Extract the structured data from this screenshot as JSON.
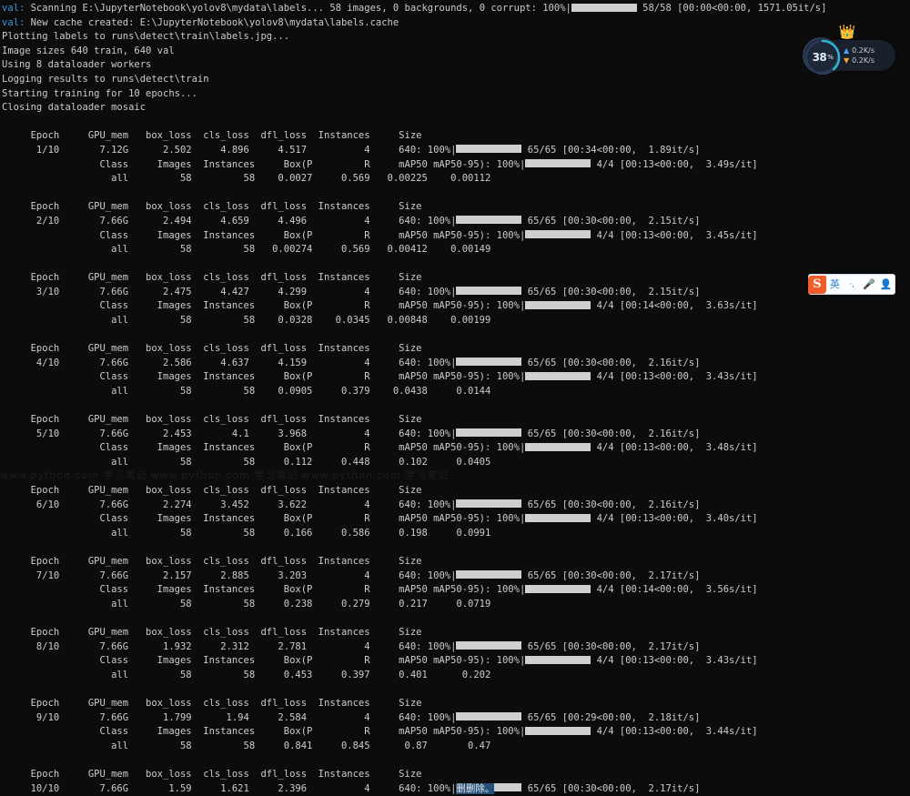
{
  "terminal": {
    "header_lines": [
      {
        "prefix": "val: ",
        "prefix_color": "cyan",
        "text": "Scanning E:\\JupyterNotebook\\yolov8\\mydata\\labels... 58 images, 0 backgrounds, 0 corrupt: 100%",
        "bar": true,
        "suffix": "58/58 [00:00<00:00, 1571.05it/s]"
      },
      {
        "prefix": "val: ",
        "prefix_color": "cyan",
        "text": "New cache created: E:\\JupyterNotebook\\yolov8\\mydata\\labels.cache",
        "bar": false,
        "suffix": ""
      },
      {
        "prefix": "",
        "prefix_color": "",
        "text": "Plotting labels to runs\\detect\\train\\labels.jpg...",
        "bar": false,
        "suffix": ""
      },
      {
        "prefix": "",
        "prefix_color": "",
        "text": "Image sizes 640 train, 640 val",
        "bar": false,
        "suffix": ""
      },
      {
        "prefix": "",
        "prefix_color": "",
        "text": "Using 8 dataloader workers",
        "bar": false,
        "suffix": ""
      },
      {
        "prefix": "",
        "prefix_color": "",
        "text": "Logging results to runs\\detect\\train",
        "bar": false,
        "suffix": ""
      },
      {
        "prefix": "",
        "prefix_color": "",
        "text": "Starting training for 10 epochs...",
        "bar": false,
        "suffix": ""
      },
      {
        "prefix": "",
        "prefix_color": "",
        "text": "Closing dataloader mosaic",
        "bar": false,
        "suffix": ""
      }
    ],
    "train_headers": [
      "Epoch",
      "GPU_mem",
      "box_loss",
      "cls_loss",
      "dfl_loss",
      "Instances",
      "Size"
    ],
    "val_headers": [
      "Class",
      "Images",
      "Instances",
      "Box(P",
      "R",
      "mAP50",
      "mAP50-95)"
    ],
    "epochs": [
      {
        "epoch": "1/10",
        "gpu_mem": "7.12G",
        "box_loss": "2.502",
        "cls_loss": "4.896",
        "dfl_loss": "4.517",
        "instances": "4",
        "size": "640",
        "train_pct": "100%",
        "train_count": "65/65",
        "train_time": "[00:34<00:00,  1.89it/s]",
        "val_pct": "100%",
        "val_count": "4/4",
        "val_time": "[00:13<00:00,  3.49s/it]",
        "class": "all",
        "images": "58",
        "val_instances": "58",
        "p": "0.0027",
        "r": "0.569",
        "map50": "0.00225",
        "map5095": "0.00112",
        "selected": false
      },
      {
        "epoch": "2/10",
        "gpu_mem": "7.66G",
        "box_loss": "2.494",
        "cls_loss": "4.659",
        "dfl_loss": "4.496",
        "instances": "4",
        "size": "640",
        "train_pct": "100%",
        "train_count": "65/65",
        "train_time": "[00:30<00:00,  2.15it/s]",
        "val_pct": "100%",
        "val_count": "4/4",
        "val_time": "[00:13<00:00,  3.45s/it]",
        "class": "all",
        "images": "58",
        "val_instances": "58",
        "p": "0.00274",
        "r": "0.569",
        "map50": "0.00412",
        "map5095": "0.00149",
        "selected": false
      },
      {
        "epoch": "3/10",
        "gpu_mem": "7.66G",
        "box_loss": "2.475",
        "cls_loss": "4.427",
        "dfl_loss": "4.299",
        "instances": "4",
        "size": "640",
        "train_pct": "100%",
        "train_count": "65/65",
        "train_time": "[00:30<00:00,  2.15it/s]",
        "val_pct": "100%",
        "val_count": "4/4",
        "val_time": "[00:14<00:00,  3.63s/it]",
        "class": "all",
        "images": "58",
        "val_instances": "58",
        "p": "0.0328",
        "r": "0.0345",
        "map50": "0.00848",
        "map5095": "0.00199",
        "selected": false
      },
      {
        "epoch": "4/10",
        "gpu_mem": "7.66G",
        "box_loss": "2.586",
        "cls_loss": "4.637",
        "dfl_loss": "4.159",
        "instances": "4",
        "size": "640",
        "train_pct": "100%",
        "train_count": "65/65",
        "train_time": "[00:30<00:00,  2.16it/s]",
        "val_pct": "100%",
        "val_count": "4/4",
        "val_time": "[00:13<00:00,  3.43s/it]",
        "class": "all",
        "images": "58",
        "val_instances": "58",
        "p": "0.0905",
        "r": "0.379",
        "map50": "0.0438",
        "map5095": "0.0144",
        "selected": false
      },
      {
        "epoch": "5/10",
        "gpu_mem": "7.66G",
        "box_loss": "2.453",
        "cls_loss": "4.1",
        "dfl_loss": "3.968",
        "instances": "4",
        "size": "640",
        "train_pct": "100%",
        "train_count": "65/65",
        "train_time": "[00:30<00:00,  2.16it/s]",
        "val_pct": "100%",
        "val_count": "4/4",
        "val_time": "[00:13<00:00,  3.48s/it]",
        "class": "all",
        "images": "58",
        "val_instances": "58",
        "p": "0.112",
        "r": "0.448",
        "map50": "0.102",
        "map5095": "0.0405",
        "selected": false
      },
      {
        "epoch": "6/10",
        "gpu_mem": "7.66G",
        "box_loss": "2.274",
        "cls_loss": "3.452",
        "dfl_loss": "3.622",
        "instances": "4",
        "size": "640",
        "train_pct": "100%",
        "train_count": "65/65",
        "train_time": "[00:30<00:00,  2.16it/s]",
        "val_pct": "100%",
        "val_count": "4/4",
        "val_time": "[00:13<00:00,  3.40s/it]",
        "class": "all",
        "images": "58",
        "val_instances": "58",
        "p": "0.166",
        "r": "0.586",
        "map50": "0.198",
        "map5095": "0.0991",
        "selected": false
      },
      {
        "epoch": "7/10",
        "gpu_mem": "7.66G",
        "box_loss": "2.157",
        "cls_loss": "2.885",
        "dfl_loss": "3.203",
        "instances": "4",
        "size": "640",
        "train_pct": "100%",
        "train_count": "65/65",
        "train_time": "[00:30<00:00,  2.17it/s]",
        "val_pct": "100%",
        "val_count": "4/4",
        "val_time": "[00:14<00:00,  3.56s/it]",
        "class": "all",
        "images": "58",
        "val_instances": "58",
        "p": "0.238",
        "r": "0.279",
        "map50": "0.217",
        "map5095": "0.0719",
        "selected": false
      },
      {
        "epoch": "8/10",
        "gpu_mem": "7.66G",
        "box_loss": "1.932",
        "cls_loss": "2.312",
        "dfl_loss": "2.781",
        "instances": "4",
        "size": "640",
        "train_pct": "100%",
        "train_count": "65/65",
        "train_time": "[00:30<00:00,  2.17it/s]",
        "val_pct": "100%",
        "val_count": "4/4",
        "val_time": "[00:13<00:00,  3.43s/it]",
        "class": "all",
        "images": "58",
        "val_instances": "58",
        "p": "0.453",
        "r": "0.397",
        "map50": "0.401",
        "map5095": "0.202",
        "selected": false
      },
      {
        "epoch": "9/10",
        "gpu_mem": "7.66G",
        "box_loss": "1.799",
        "cls_loss": "1.94",
        "dfl_loss": "2.584",
        "instances": "4",
        "size": "640",
        "train_pct": "100%",
        "train_count": "65/65",
        "train_time": "[00:29<00:00,  2.18it/s]",
        "val_pct": "100%",
        "val_count": "4/4",
        "val_time": "[00:13<00:00,  3.44s/it]",
        "class": "all",
        "images": "58",
        "val_instances": "58",
        "p": "0.841",
        "r": "0.845",
        "map50": "0.87",
        "map5095": "0.47",
        "selected": false
      },
      {
        "epoch": "10/10",
        "gpu_mem": "7.66G",
        "box_loss": "1.59",
        "cls_loss": "1.621",
        "dfl_loss": "2.396",
        "instances": "4",
        "size": "640",
        "train_pct": "100%",
        "train_count": "65/65",
        "train_time": "[00:30<00:00,  2.17it/s]",
        "selection_text": "删删除。",
        "selected": true,
        "partial": true
      }
    ]
  },
  "net_widget": {
    "percent": "38",
    "percent_unit": "%",
    "upload_rate": "0.2K/s",
    "download_rate": "0.2K/s",
    "upload_arrow": "▲",
    "download_arrow": "▼",
    "crown_icon": "crown-badge-icon",
    "ring_color": "#2bb6d6"
  },
  "ime_bar": {
    "logo": "S",
    "mode_label": "英",
    "punctuation_label": "·,",
    "mic_icon": "microphone-icon",
    "user_icon": "user-account-icon"
  },
  "watermark": {
    "text": "www.python.com  学习笔记  www.python.com  学习笔记  www.python.com  学习笔记"
  }
}
